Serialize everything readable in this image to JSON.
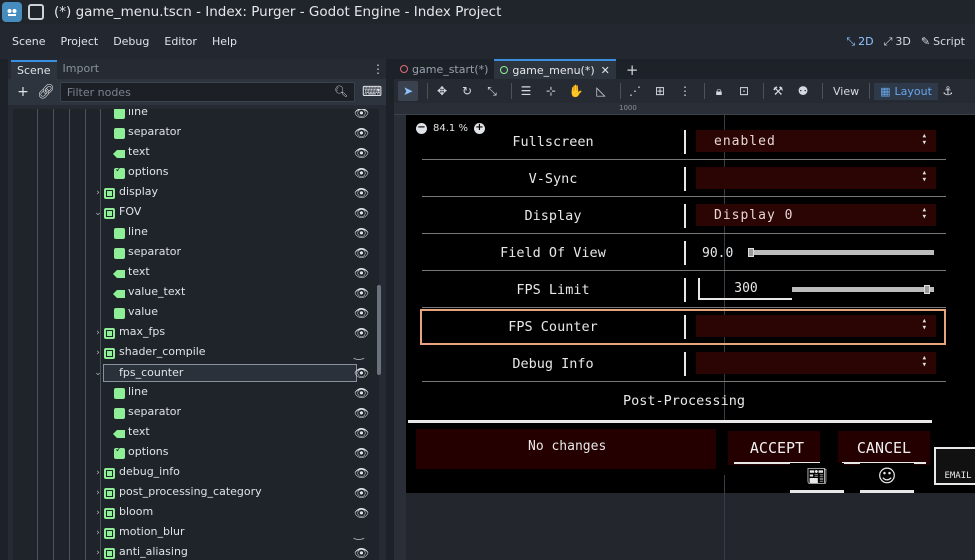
{
  "window": {
    "title": "(*) game_menu.tscn - Index: Purger - Godot Engine - Index Project"
  },
  "menubar": {
    "items": [
      "Scene",
      "Project",
      "Debug",
      "Editor",
      "Help"
    ],
    "modes": [
      "2D",
      "3D",
      "Script"
    ]
  },
  "scene_dock": {
    "tabs": [
      "Scene",
      "Import"
    ],
    "filter_placeholder": "Filter nodes",
    "nodes": [
      {
        "label": "line",
        "icon": "line-icon"
      },
      {
        "label": "separator",
        "icon": "separator-icon"
      },
      {
        "label": "text",
        "icon": "label-icon"
      },
      {
        "label": "options",
        "icon": "option-button-icon"
      },
      {
        "label": "display",
        "icon": "container-icon"
      },
      {
        "label": "FOV",
        "icon": "container-icon"
      },
      {
        "label": "line",
        "icon": "line-icon"
      },
      {
        "label": "separator",
        "icon": "separator-icon"
      },
      {
        "label": "text",
        "icon": "label-icon"
      },
      {
        "label": "value_text",
        "icon": "label-icon"
      },
      {
        "label": "value",
        "icon": "slider-icon"
      },
      {
        "label": "max_fps",
        "icon": "container-icon"
      },
      {
        "label": "shader_compile",
        "icon": "container-icon"
      },
      {
        "label": "fps_counter",
        "icon": "container-icon"
      },
      {
        "label": "line",
        "icon": "line-icon"
      },
      {
        "label": "separator",
        "icon": "separator-icon"
      },
      {
        "label": "text",
        "icon": "label-icon"
      },
      {
        "label": "options",
        "icon": "option-button-icon"
      },
      {
        "label": "debug_info",
        "icon": "container-icon"
      },
      {
        "label": "post_processing_category",
        "icon": "container-icon"
      },
      {
        "label": "bloom",
        "icon": "container-icon"
      },
      {
        "label": "motion_blur",
        "icon": "container-icon"
      },
      {
        "label": "anti_aliasing",
        "icon": "container-icon"
      }
    ]
  },
  "editor_tabs": [
    "game_start(*)",
    "game_menu(*)"
  ],
  "toolbar": {
    "view_label": "View",
    "layout_label": "Layout"
  },
  "viewport": {
    "zoom": "84.1 %",
    "ruler_mark": "1000",
    "settings": [
      {
        "label": "Fullscreen",
        "value": "enabled"
      },
      {
        "label": "V-Sync",
        "value": ""
      },
      {
        "label": "Display",
        "value": "Display 0"
      },
      {
        "label": "Field Of View",
        "value": "90.0"
      },
      {
        "label": "FPS Limit",
        "value": "300"
      },
      {
        "label": "FPS Counter",
        "value": ""
      },
      {
        "label": "Debug Info",
        "value": ""
      }
    ],
    "category": "Post-Processing",
    "status": "No changes",
    "accept_label": "ACCEPT",
    "cancel_label": "CANCEL",
    "email_label": "EMAIL"
  },
  "colors": {
    "accent": "#3a8fe0",
    "node_icon": "#8eef97",
    "highlight": "#e8a47e",
    "dropdown_bg": "#2b0404"
  }
}
